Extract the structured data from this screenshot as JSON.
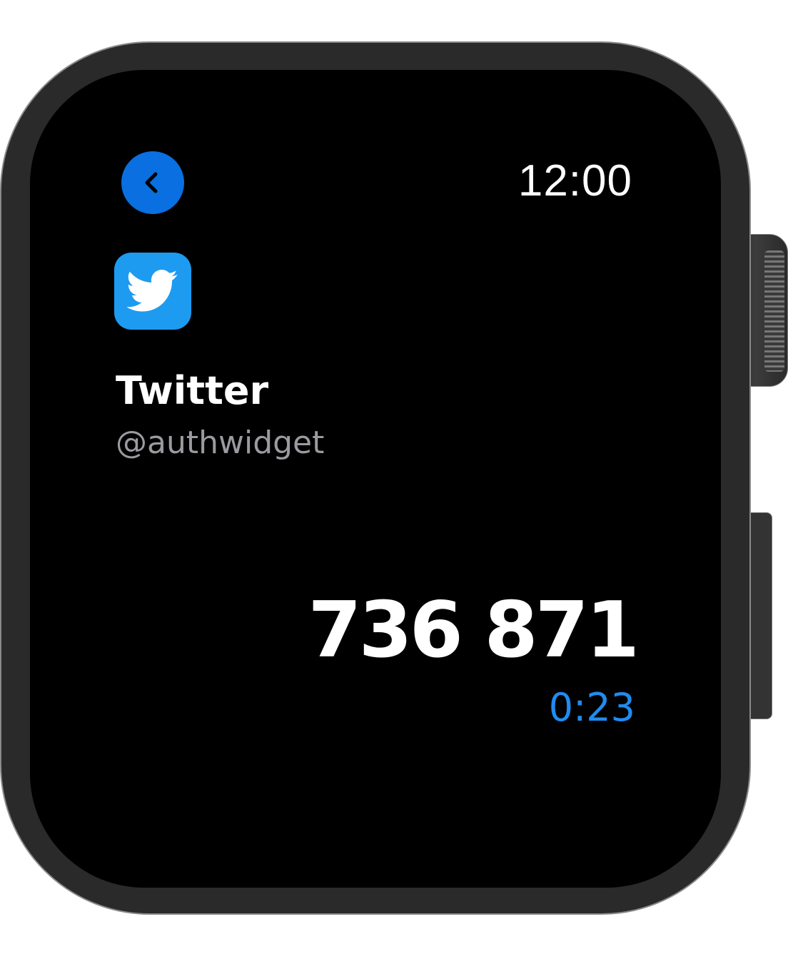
{
  "status_bar": {
    "time": "12:00"
  },
  "navigation": {
    "back_icon": "chevron-left-icon",
    "back_color": "#0a6fe0"
  },
  "account": {
    "app_icon": "twitter-bird-icon",
    "icon_color": "#1d9bf0",
    "name": "Twitter",
    "handle": "@authwidget"
  },
  "otp": {
    "code": "736 871",
    "time_remaining": "0:23",
    "timer_color": "#1f8cf0"
  }
}
